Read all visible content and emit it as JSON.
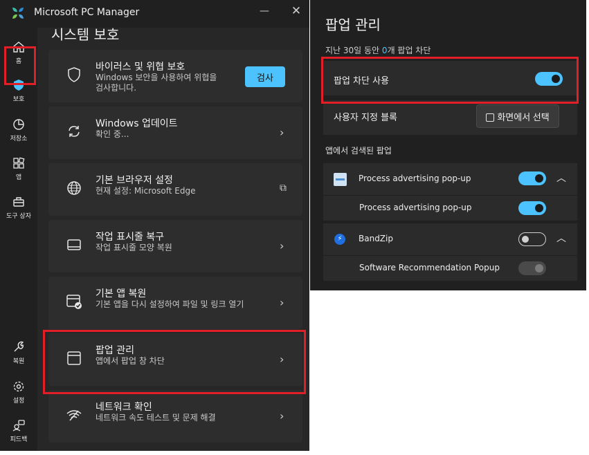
{
  "window": {
    "title": "Microsoft PC Manager",
    "minimize": "—",
    "close": "✕"
  },
  "nav": {
    "items": [
      {
        "label": "홈",
        "icon": "home-icon"
      },
      {
        "label": "보호",
        "icon": "shield-icon"
      },
      {
        "label": "저장소",
        "icon": "pie-chart-icon"
      },
      {
        "label": "앱",
        "icon": "apps-icon"
      },
      {
        "label": "도구 상자",
        "icon": "toolbox-icon"
      },
      {
        "label": "복원",
        "icon": "wrench-icon"
      },
      {
        "label": "설정",
        "icon": "gear-icon"
      },
      {
        "label": "피드백",
        "icon": "feedback-icon"
      }
    ],
    "active": "보호"
  },
  "main": {
    "section_title": "시스템 보호",
    "cards": [
      {
        "title": "바이러스 및 위협 보호",
        "subtitle_line1": "Windows 보안을 사용하여 위협을",
        "subtitle_line2": "검사합니다.",
        "action": "검사",
        "icon": "shield-outline-icon"
      },
      {
        "title": "Windows 업데이트",
        "subtitle": "확인 중...",
        "icon": "sync-icon",
        "chevron": "›"
      },
      {
        "title": "기본 브라우저 설정",
        "subtitle": "현재 설정: Microsoft Edge",
        "icon": "globe-icon",
        "chevron": "⧉"
      },
      {
        "title": "작업 표시줄 복구",
        "subtitle": "작업 표시줄 모양 복원",
        "icon": "taskbar-icon",
        "chevron": "›"
      },
      {
        "title": "기본 앱 복원",
        "subtitle": "기본 앱을 다시 설정하여 파일 및 링크 열기",
        "icon": "default-app-icon",
        "chevron": "›"
      },
      {
        "title": "팝업 관리",
        "subtitle": "앱에서 팝업 창 차단",
        "icon": "window-icon",
        "chevron": "›"
      },
      {
        "title": "네트워크 확인",
        "subtitle": "네트워크 속도 테스트 및 문제 해결",
        "icon": "network-icon",
        "chevron": "›"
      }
    ]
  },
  "popup_panel": {
    "title": "팝업 관리",
    "summary_prefix": "지난 30일 동안 ",
    "summary_count": "0",
    "summary_suffix": "개 팝업 차단",
    "enable_label": "팝업 차단 사용",
    "enable_on": true,
    "custom_block_label": "사용자 지정 블록",
    "select_button": "화면에서 선택",
    "detected_label": "앱에서 검색된 팝업",
    "apps": [
      {
        "name": "Process advertising pop-up",
        "enabled": true,
        "children": [
          {
            "name": "Process advertising pop-up",
            "enabled": true
          }
        ]
      },
      {
        "name": "BandZip",
        "enabled": false,
        "children": [
          {
            "name": "Software Recommendation Popup",
            "enabled": true,
            "disabled": true
          }
        ]
      }
    ]
  },
  "colors": {
    "accent": "#4cc2ff",
    "highlight": "#e21f26",
    "background": "#202020",
    "card": "#2d2d2d"
  }
}
